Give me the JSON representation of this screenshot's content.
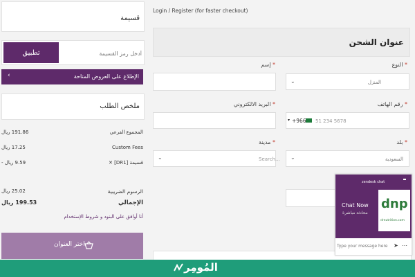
{
  "sidebar": {
    "coupon_title": "قسيمة",
    "coupon_placeholder": "أدخل رمز القسيمة",
    "apply_label": "تطبيق",
    "offers_label": "الإطلاع على العروض المتاحة",
    "summary_title": "ملخص الطلب",
    "rows": [
      {
        "label": "المجموع الفرعي",
        "value": "191.86 ريال"
      },
      {
        "label": "Custom Fees",
        "value": "17.25 ريال"
      },
      {
        "label": "قسيمة [DR1] ✕",
        "value": "9.59 ريال -"
      }
    ],
    "taxes_label": "الرسوم الضريبية",
    "taxes_value": "25.02 ريال",
    "total_label": "الإجمالي",
    "total_value": "199.53 ريال",
    "terms_label": "أنا أوافق على البنود و شروط الإستخدام",
    "choose_address_label": "اختر العنوان"
  },
  "main": {
    "login_link": "Login / Register (for faster checkout)",
    "section_title": "عنوان الشحن",
    "type_label": "النوع",
    "type_value": "المنزل",
    "name_label": "إسم",
    "phone_label": "رقم الهاتف",
    "phone_prefix": "+966",
    "phone_placeholder": "51 234 5678",
    "email_label": "البريد الالكتروني",
    "country_label": "بلد",
    "country_value": "السعودية",
    "city_label": "مدينة",
    "city_placeholder": "Search..."
  },
  "chat": {
    "header": "zendesk chat",
    "chat_now": "Chat Now",
    "subtitle": "محادثة مباشرة",
    "logo_text": "dnp",
    "logo_sub": "drnutrition.com",
    "placeholder": "Type your message here"
  },
  "footer": {
    "brand": "المُومِر"
  },
  "colors": {
    "purple": "#5e2a6a",
    "brand_green": "#1f9d7a",
    "flag_green": "#1d7b3a"
  }
}
